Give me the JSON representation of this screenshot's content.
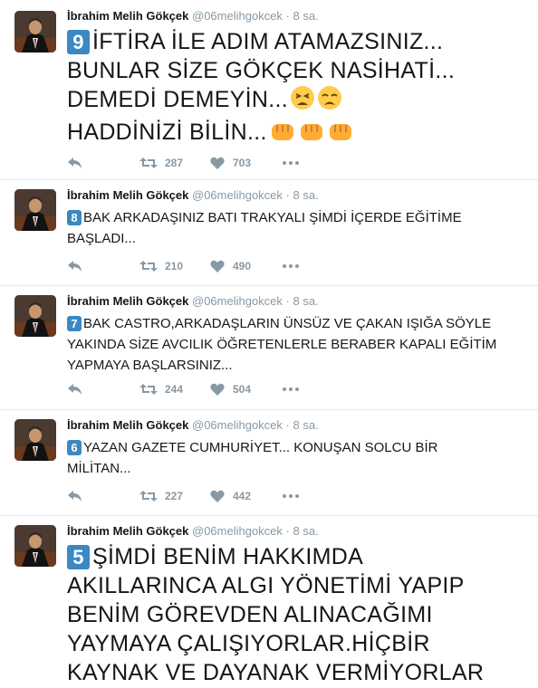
{
  "tweets": [
    {
      "name": "İbrahim Melih Gökçek",
      "handle": "@06melihgokcek",
      "dot": "·",
      "time": "8 sa.",
      "number": "9",
      "lines": [
        "İFTİRA İLE ADIM ATAMAZSINIZ...",
        "BUNLAR SİZE GÖKÇEK NASİHATİ...",
        "DEMEDİ DEMEYİN...",
        "HADDİNİZİ BİLİN..."
      ],
      "emoji_line2": [
        "tired-face-emoji",
        "weary-face-emoji"
      ],
      "emoji_line3": [
        "fist-emoji",
        "fist-emoji",
        "fist-emoji"
      ],
      "retweets": "287",
      "likes": "703"
    },
    {
      "name": "İbrahim Melih Gökçek",
      "handle": "@06melihgokcek",
      "dot": "·",
      "time": "8 sa.",
      "number": "8",
      "lines": [
        "BAK ARKADAŞINIZ BATI TRAKYALI ŞİMDİ İÇERDE EĞİTİME",
        "BAŞLADI..."
      ],
      "retweets": "210",
      "likes": "490"
    },
    {
      "name": "İbrahim Melih Gökçek",
      "handle": "@06melihgokcek",
      "dot": "·",
      "time": "8 sa.",
      "number": "7",
      "lines": [
        "BAK CASTRO,ARKADAŞLARIN ÜNSÜZ VE ÇAKAN IŞIĞA SÖYLE",
        "YAKINDA SİZE AVCILIK ÖĞRETENLERLE BERABER KAPALI EĞİTİM",
        "YAPMAYA BAŞLARSINIZ..."
      ],
      "retweets": "244",
      "likes": "504"
    },
    {
      "name": "İbrahim Melih Gökçek",
      "handle": "@06melihgokcek",
      "dot": "·",
      "time": "8 sa.",
      "number": "6",
      "lines": [
        "YAZAN GAZETE CUMHURİYET... KONUŞAN SOLCU BİR",
        "MİLİTAN..."
      ],
      "retweets": "227",
      "likes": "442"
    },
    {
      "name": "İbrahim Melih Gökçek",
      "handle": "@06melihgokcek",
      "dot": "·",
      "time": "8 sa.",
      "number": "5",
      "lines": [
        "ŞİMDİ BENİM HAKKIMDA",
        "AKILLARINCA ALGI YÖNETİMİ YAPIP",
        "BENİM GÖREVDEN ALINACAĞIMI",
        "YAYMAYA ÇALIŞIYORLAR.HİÇBİR",
        "KAYNAK VE DAYANAK VERMİYORLAR"
      ]
    }
  ],
  "colors": {
    "keycap": "#3b88c3",
    "meta": "#8899a6",
    "border": "#e1e8ed"
  }
}
